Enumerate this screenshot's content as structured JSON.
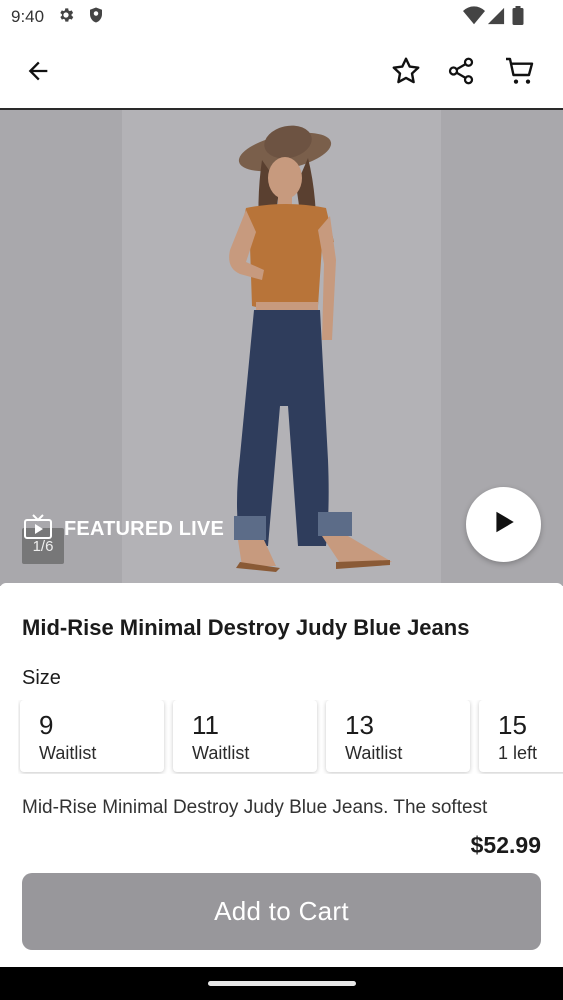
{
  "status_bar": {
    "time": "9:40",
    "left_icons": [
      "gear-icon",
      "shield-icon"
    ],
    "right_icons": [
      "wifi-icon",
      "signal-icon",
      "battery-icon"
    ]
  },
  "app_bar": {
    "icons": [
      "back-arrow-icon",
      "star-icon",
      "share-icon",
      "cart-icon"
    ]
  },
  "hero": {
    "featured_label": "FEATURED LIVE",
    "image_counter": "1/6",
    "featured_icon": "tv-play-icon",
    "play_icon": "play-icon"
  },
  "product": {
    "title": "Mid-Rise Minimal Destroy Judy Blue Jeans",
    "size_label": "Size",
    "sizes": [
      {
        "size": "9",
        "status": "Waitlist"
      },
      {
        "size": "11",
        "status": "Waitlist"
      },
      {
        "size": "13",
        "status": "Waitlist"
      },
      {
        "size": "15",
        "status": "1 left"
      }
    ],
    "description": "Mid-Rise Minimal Destroy Judy Blue Jeans. The softest",
    "price": "$52.99",
    "add_to_cart_label": "Add to Cart"
  },
  "colors": {
    "hero_bg": "#a9a8ac",
    "button_disabled": "#98979b"
  }
}
